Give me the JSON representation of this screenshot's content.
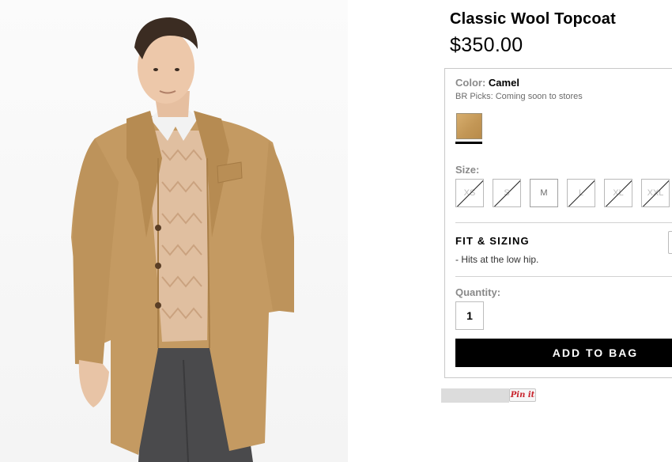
{
  "product": {
    "title": "Classic Wool Topcoat",
    "price": "$350.00",
    "image_alt": "product-photo-camel-topcoat"
  },
  "color": {
    "label": "Color:",
    "value": "Camel",
    "note": "BR Picks: Coming soon to stores",
    "swatch_color": "#c69a59"
  },
  "size": {
    "label": "Size:",
    "options": [
      {
        "label": "XS",
        "available": false
      },
      {
        "label": "S",
        "available": false
      },
      {
        "label": "M",
        "available": true
      },
      {
        "label": "L",
        "available": false
      },
      {
        "label": "XL",
        "available": false
      },
      {
        "label": "XXL",
        "available": false
      }
    ]
  },
  "fit": {
    "title": "FIT & SIZING",
    "items": [
      "-  Hits at the low hip."
    ]
  },
  "quantity": {
    "label": "Quantity:",
    "value": "1"
  },
  "actions": {
    "add_to_bag": "ADD TO BAG",
    "pinterest": "Pin it"
  },
  "colors": {
    "coat": "#c49a62",
    "button_bg": "#000000",
    "pinterest_red": "#c8232c"
  }
}
